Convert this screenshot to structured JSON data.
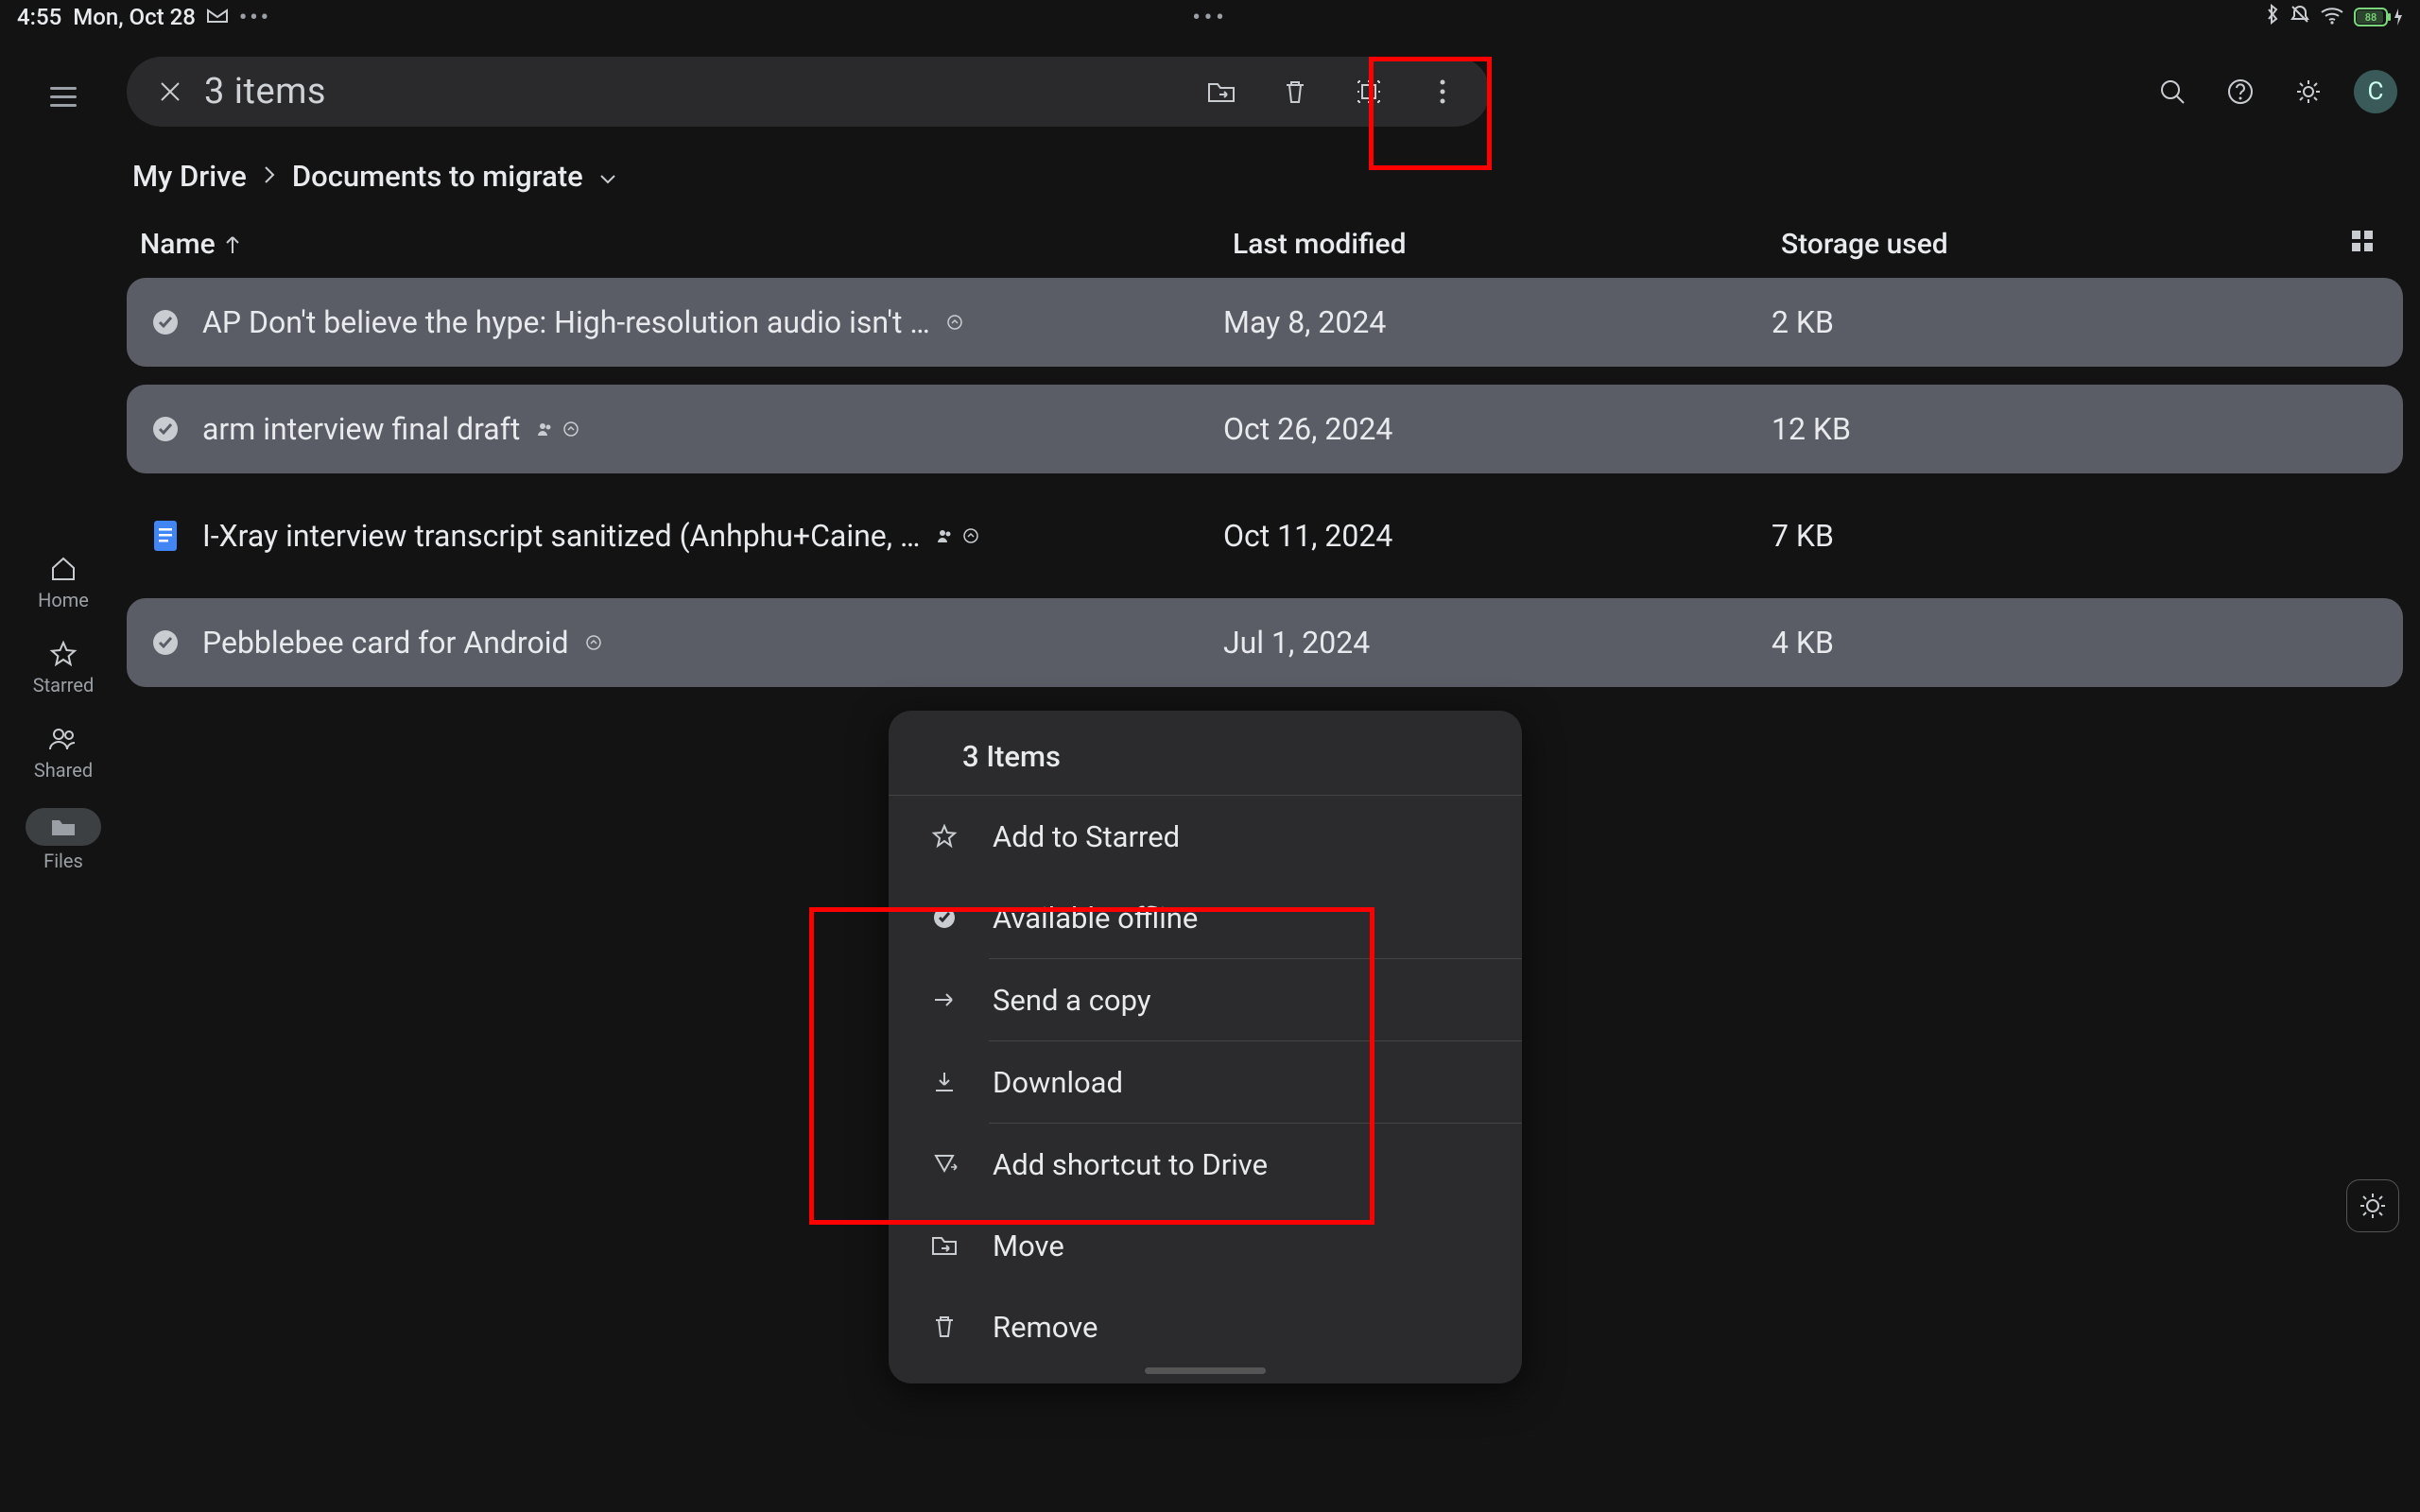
{
  "status": {
    "time": "4:55",
    "date": "Mon, Oct 28",
    "battery": "88"
  },
  "sidebar": {
    "items": [
      {
        "label": "Home"
      },
      {
        "label": "Starred"
      },
      {
        "label": "Shared"
      },
      {
        "label": "Files"
      }
    ]
  },
  "selection": {
    "count_label": "3 items"
  },
  "header_actions": {
    "avatar_initial": "C"
  },
  "breadcrumb": {
    "root": "My Drive",
    "current": "Documents to migrate"
  },
  "columns": {
    "name": "Name",
    "modified": "Last modified",
    "size": "Storage used"
  },
  "files": [
    {
      "name": "AP Don't believe the hype: High-resolution audio isn't …",
      "modified": "May 8, 2024",
      "size": "2 KB",
      "selected": true,
      "type": "doc",
      "badges": [
        "offline"
      ]
    },
    {
      "name": "arm interview final draft",
      "modified": "Oct 26, 2024",
      "size": "12 KB",
      "selected": true,
      "type": "doc",
      "badges": [
        "shared",
        "offline"
      ]
    },
    {
      "name": "I-Xray interview transcript sanitized (Anhphu+Caine, …",
      "modified": "Oct 11, 2024",
      "size": "7 KB",
      "selected": false,
      "type": "doc",
      "badges": [
        "shared",
        "offline"
      ]
    },
    {
      "name": "Pebblebee card for Android",
      "modified": "Jul 1, 2024",
      "size": "4 KB",
      "selected": true,
      "type": "doc",
      "badges": [
        "offline"
      ]
    }
  ],
  "menu": {
    "title": "3 Items",
    "items": [
      {
        "label": "Add to Starred",
        "icon": "star"
      },
      {
        "label": "Available offline",
        "icon": "offline"
      },
      {
        "label": "Send a copy",
        "icon": "send"
      },
      {
        "label": "Download",
        "icon": "download"
      },
      {
        "label": "Add shortcut to Drive",
        "icon": "shortcut"
      },
      {
        "label": "Move",
        "icon": "move"
      },
      {
        "label": "Remove",
        "icon": "trash"
      }
    ]
  }
}
